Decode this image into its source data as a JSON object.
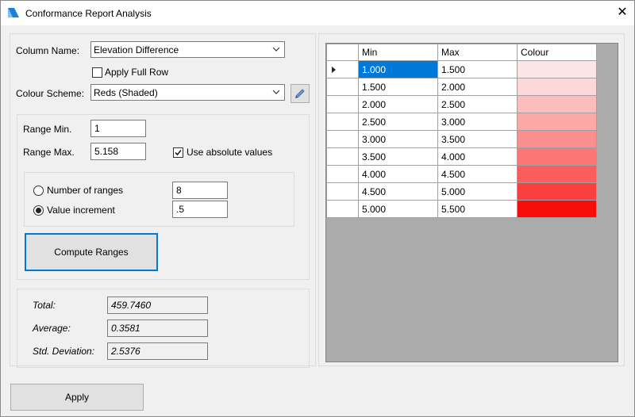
{
  "window": {
    "title": "Conformance Report Analysis",
    "close_glyph": "✕"
  },
  "form": {
    "column_name_label": "Column Name:",
    "column_name_value": "Elevation Difference",
    "apply_full_row_label": "Apply Full Row",
    "apply_full_row_checked": false,
    "colour_scheme_label": "Colour Scheme:",
    "colour_scheme_value": "Reds (Shaded)",
    "range_min_label": "Range Min.",
    "range_min_value": "1",
    "range_max_label": "Range Max.",
    "range_max_value": "5.158",
    "use_absolute_label": "Use absolute values",
    "use_absolute_checked": true,
    "number_of_ranges_label": "Number of ranges",
    "number_of_ranges_value": "8",
    "value_increment_label": "Value increment",
    "value_increment_value": ".5",
    "selected_mode": "value_increment",
    "compute_button": "Compute Ranges"
  },
  "stats": {
    "total_label": "Total:",
    "total_value": "459.7460",
    "average_label": "Average:",
    "average_value": "0.3581",
    "std_label": "Std. Deviation:",
    "std_value": "2.5376"
  },
  "grid": {
    "headers": [
      "Min",
      "Max",
      "Colour"
    ],
    "rows": [
      {
        "min": "1.000",
        "max": "1.500",
        "colour": "#fee5e5"
      },
      {
        "min": "1.500",
        "max": "2.000",
        "colour": "#fdd8d8"
      },
      {
        "min": "2.000",
        "max": "2.500",
        "colour": "#fcbcbc"
      },
      {
        "min": "2.500",
        "max": "3.000",
        "colour": "#fca8a8"
      },
      {
        "min": "3.000",
        "max": "3.500",
        "colour": "#fb8f8f"
      },
      {
        "min": "3.500",
        "max": "4.000",
        "colour": "#fb7777"
      },
      {
        "min": "4.000",
        "max": "4.500",
        "colour": "#fa5d5d"
      },
      {
        "min": "4.500",
        "max": "5.000",
        "colour": "#f93f3f"
      },
      {
        "min": "5.000",
        "max": "5.500",
        "colour": "#f80d0d"
      }
    ]
  },
  "footer": {
    "apply_button": "Apply"
  },
  "icons": {
    "app": "bricscad-logo-icon",
    "edit": "pencil-icon",
    "dropdown": "chevron-down-icon",
    "close": "close-icon"
  },
  "colors": {
    "accent": "#0078d7",
    "grid_background": "#ababab"
  }
}
